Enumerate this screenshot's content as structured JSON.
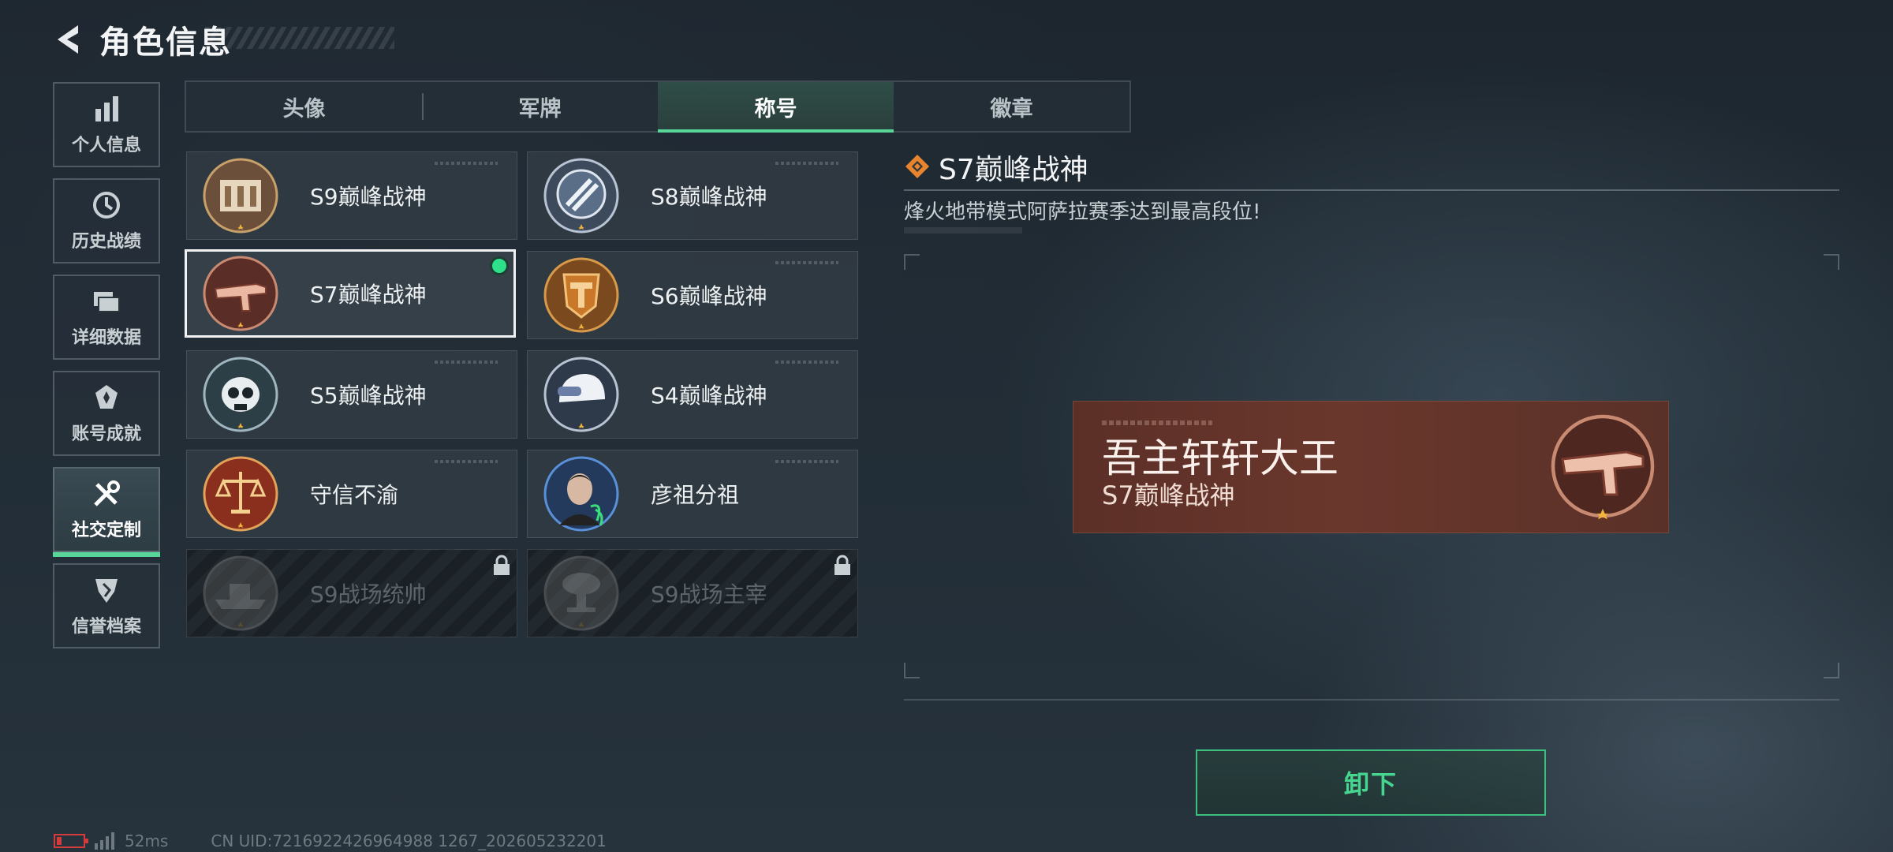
{
  "header": {
    "title": "角色信息"
  },
  "sidebar": {
    "items": [
      {
        "label": "个人信息",
        "icon": "bar-chart-icon"
      },
      {
        "label": "历史战绩",
        "icon": "history-icon"
      },
      {
        "label": "详细数据",
        "icon": "folder-icon"
      },
      {
        "label": "账号成就",
        "icon": "achievement-icon"
      },
      {
        "label": "社交定制",
        "icon": "tools-icon",
        "active": true
      },
      {
        "label": "信誉档案",
        "icon": "shield-icon"
      }
    ]
  },
  "tabs": [
    {
      "label": "头像"
    },
    {
      "label": "军牌"
    },
    {
      "label": "称号",
      "active": true
    },
    {
      "label": "徽章"
    }
  ],
  "titles": [
    {
      "name": "S9巅峰战神",
      "medal": "fortress-medal-icon"
    },
    {
      "name": "S8巅峰战神",
      "medal": "slash-emblem-medal-icon"
    },
    {
      "name": "S7巅峰战神",
      "medal": "gun-medal-icon",
      "selected": true,
      "equipped": true
    },
    {
      "name": "S6巅峰战神",
      "medal": "t-shield-medal-icon"
    },
    {
      "name": "S5巅峰战神",
      "medal": "skull-medal-icon"
    },
    {
      "name": "S4巅峰战神",
      "medal": "helmet-medal-icon"
    },
    {
      "name": "守信不渝",
      "medal": "scales-medal-icon"
    },
    {
      "name": "彦祖分祖",
      "medal": "portrait-medal-icon"
    },
    {
      "name": "S9战场统帅",
      "medal": "ship-medal-icon",
      "locked": true
    },
    {
      "name": "S9战场主宰",
      "medal": "mushroom-cloud-medal-icon",
      "locked": true
    }
  ],
  "detail": {
    "name": "S7巅峰战神",
    "description": "烽火地带模式阿萨拉赛季达到最高段位!"
  },
  "banner": {
    "player_name": "吾主轩轩大王",
    "title": "S7巅峰战神"
  },
  "actions": {
    "unequip_label": "卸下"
  },
  "footer": {
    "ping": "52ms",
    "uid": "CN UID:7216922426964988 1267_202605232201"
  },
  "colors": {
    "accent": "#58d69a",
    "banner": "#6a372c",
    "battery": "#d63b3b"
  }
}
